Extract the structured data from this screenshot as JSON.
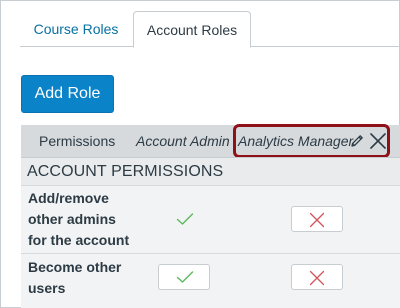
{
  "tabs": [
    {
      "label": "Course Roles",
      "active": false
    },
    {
      "label": "Account Roles",
      "active": true
    }
  ],
  "add_role_button": "Add Role",
  "table": {
    "columns": [
      "Permissions",
      "Account Admin",
      "Analytics Manager"
    ],
    "section_title": "ACCOUNT PERMISSIONS",
    "rows": [
      {
        "label": "Add/remove other admins for the account",
        "account_admin": "enabled",
        "analytics_manager": "disabled"
      },
      {
        "label": "Become other users",
        "account_admin": "enabled",
        "analytics_manager": "disabled"
      }
    ]
  },
  "icons": {
    "edit": "pencil-icon",
    "delete": "close-icon",
    "enabled": "check-icon",
    "disabled": "x-icon"
  },
  "colors": {
    "link": "#0770a3",
    "button": "#0b83c9",
    "highlight": "#8f1018",
    "check": "#5cb85c",
    "x": "#d0555c",
    "header_bg": "#d6dadd"
  }
}
